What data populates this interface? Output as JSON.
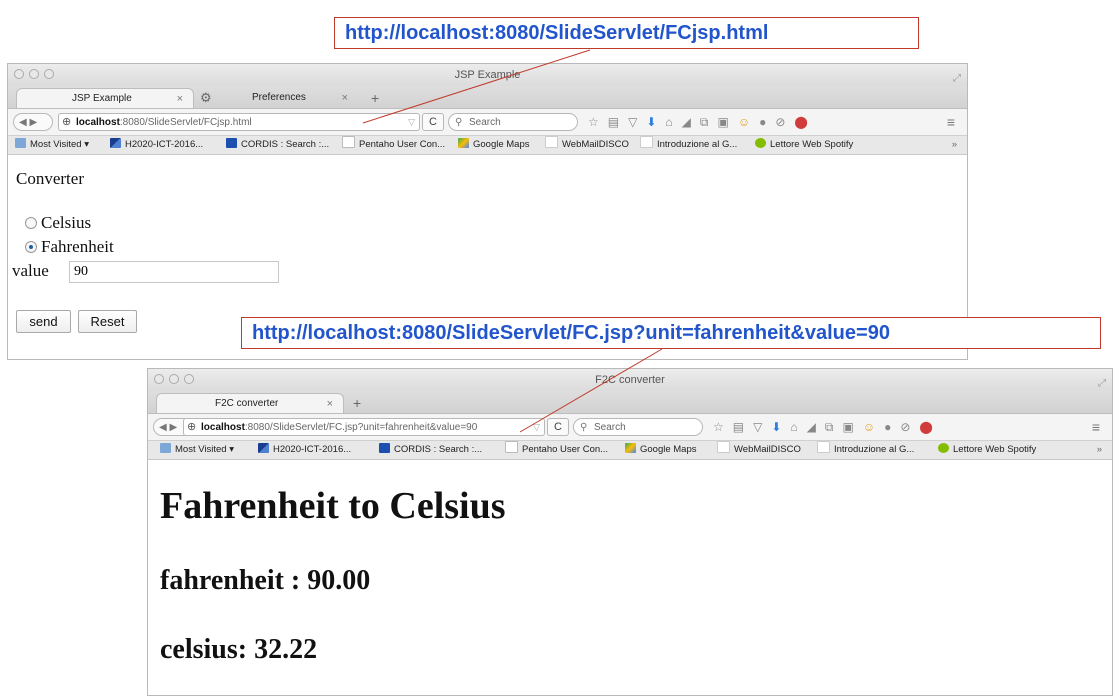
{
  "callouts": {
    "top": "http://localhost:8080/SlideServlet/FCjsp.html",
    "bottom": "http://localhost:8080/SlideServlet/FC.jsp?unit=fahrenheit&value=90"
  },
  "browser_chrome": {
    "bookmarks": [
      "Most Visited",
      "H2020-ICT-2016...",
      "CORDIS : Search :...",
      "Pentaho User Con...",
      "Google Maps",
      "WebMailDISCO",
      "Introduzione al G...",
      "Lettore Web Spotify"
    ],
    "search_placeholder": "Search",
    "icons": [
      "back-icon",
      "forward-icon",
      "globe-icon",
      "reload-icon",
      "search-icon",
      "star-icon",
      "reading-list-icon",
      "pocket-icon",
      "download-icon",
      "home-icon",
      "send-icon",
      "screenshot-icon",
      "addon-icon",
      "chat-icon",
      "block-icon",
      "adblock-icon",
      "menu-icon"
    ]
  },
  "window1": {
    "title": "JSP Example",
    "tabs": [
      {
        "label": "JSP Example",
        "close": "×"
      },
      {
        "label": "Preferences",
        "close": "×"
      }
    ],
    "url_host": "localhost",
    "url_rest": ":8080/SlideServlet/FCjsp.html",
    "page": {
      "heading": "Converter",
      "radio_celsius": "Celsius",
      "radio_fahrenheit": "Fahrenheit",
      "selected": "Fahrenheit",
      "value_label": "value",
      "value": "90",
      "send_button": "send",
      "reset_button": "Reset"
    }
  },
  "window2": {
    "title": "F2C converter",
    "tabs": [
      {
        "label": "F2C converter",
        "close": "×"
      }
    ],
    "url_host": "localhost",
    "url_rest": ":8080/SlideServlet/FC.jsp?unit=fahrenheit&value=90",
    "page": {
      "heading": "Fahrenheit to Celsius",
      "line1": "fahrenheit : 90.00",
      "line2": "celsius: 32.22"
    }
  }
}
